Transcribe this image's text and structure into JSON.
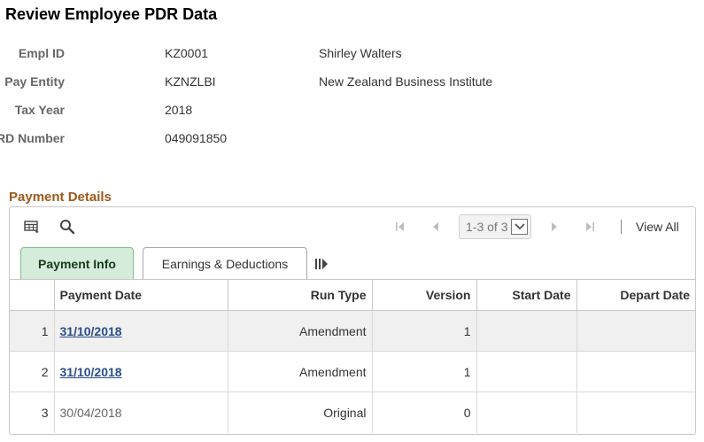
{
  "page": {
    "title": "Review Employee PDR Data"
  },
  "employee": {
    "empl_id_label": "Empl ID",
    "empl_id": "KZ0001",
    "name": "Shirley Walters",
    "pay_entity_label": "Pay Entity",
    "pay_entity": "KZNZLBI",
    "pay_entity_desc": "New Zealand Business Institute",
    "tax_year_label": "Tax Year",
    "tax_year": "2018",
    "ird_label": "IRD Number",
    "ird_number": "049091850"
  },
  "payment_details": {
    "title": "Payment Details",
    "pager_text": "1-3 of 3",
    "view_all": "View All",
    "tabs": [
      {
        "label": "Payment Info",
        "active": true
      },
      {
        "label": "Earnings & Deductions",
        "active": false
      }
    ],
    "columns": [
      "Payment Date",
      "Run Type",
      "Version",
      "Start Date",
      "Depart Date"
    ],
    "rows": [
      {
        "num": "1",
        "payment_date": "31/10/2018",
        "run_type": "Amendment",
        "version": "1",
        "start_date": "",
        "depart_date": ""
      },
      {
        "num": "2",
        "payment_date": "31/10/2018",
        "run_type": "Amendment",
        "version": "1",
        "start_date": "",
        "depart_date": ""
      },
      {
        "num": "3",
        "payment_date": "30/04/2018",
        "run_type": "Original",
        "version": "0",
        "start_date": "",
        "depart_date": ""
      }
    ]
  },
  "colors": {
    "section_title": "#a0581a",
    "active_tab": "#d4ecd9",
    "link": "#2a4d8a"
  },
  "icons": [
    "personalize-grid-icon",
    "search-icon",
    "first-page-icon",
    "previous-page-icon",
    "chevron-down-icon",
    "next-page-icon",
    "last-page-icon",
    "show-all-columns-icon"
  ]
}
